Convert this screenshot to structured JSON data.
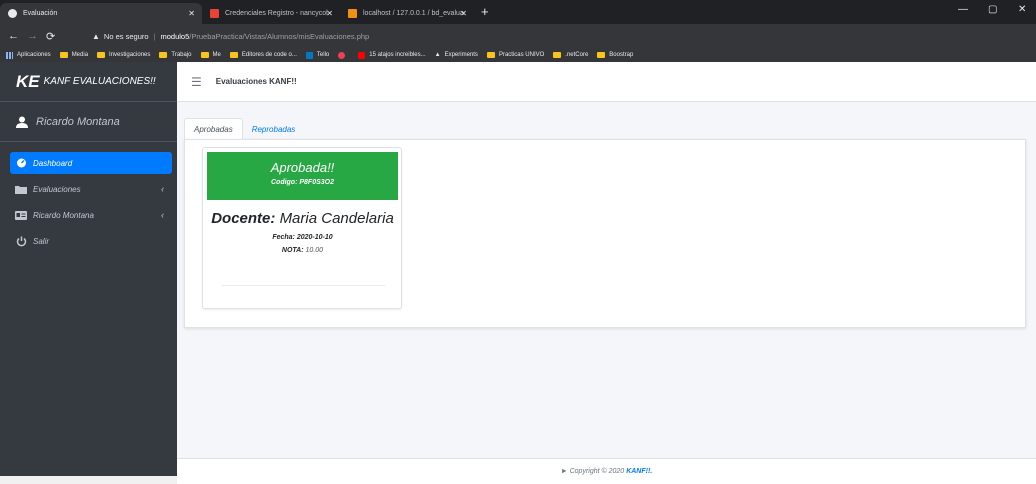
{
  "browser": {
    "tabs": [
      {
        "title": "Evaluación",
        "active": true
      },
      {
        "title": "Credenciales Registro - nancycol"
      },
      {
        "title": "localhost / 127.0.0.1 / bd_evalua"
      }
    ],
    "url": {
      "warning": "No es seguro",
      "host": "modulo5",
      "path": "/PruebaPractica/Vistas/Alumnos/misEvaluaciones.php"
    },
    "bookmarks": [
      "Aplicaciones",
      "Media",
      "Investigaciones",
      "Trabajo",
      "Me",
      "Editores de code o...",
      "Tello",
      "",
      "15 atajos increibles...",
      "Experiments",
      "Practicas UNIVO",
      ".netCore",
      "Boostrap"
    ]
  },
  "sidebar": {
    "brand_abbr": "KE",
    "brand_name": "KANF EVALUACIONES!!",
    "user_name": "Ricardo Montana",
    "items": [
      {
        "label": "Dashboard",
        "active": true
      },
      {
        "label": "Evaluaciones",
        "chevron": "‹"
      },
      {
        "label": "Ricardo Montana",
        "chevron": "‹"
      },
      {
        "label": "Salir"
      }
    ]
  },
  "header": {
    "title": "Evaluaciones KANF!!"
  },
  "tabs": [
    {
      "label": "Aprobadas",
      "active": true
    },
    {
      "label": "Reprobadas"
    }
  ],
  "card": {
    "status": "Aprobada!!",
    "code": "Codigo: P8F0S3O2",
    "docente_label": "Docente:",
    "docente_name": "Maria Candelaria",
    "fecha": "Fecha: 2020-10-10",
    "nota_label": "NOTA:",
    "nota_value": "10.00"
  },
  "footer": {
    "text": "► Copyright © 2020",
    "brand": "KANF!!."
  },
  "colors": {
    "sidebar": "#343a40",
    "active": "#007bff",
    "success": "#28a745"
  }
}
